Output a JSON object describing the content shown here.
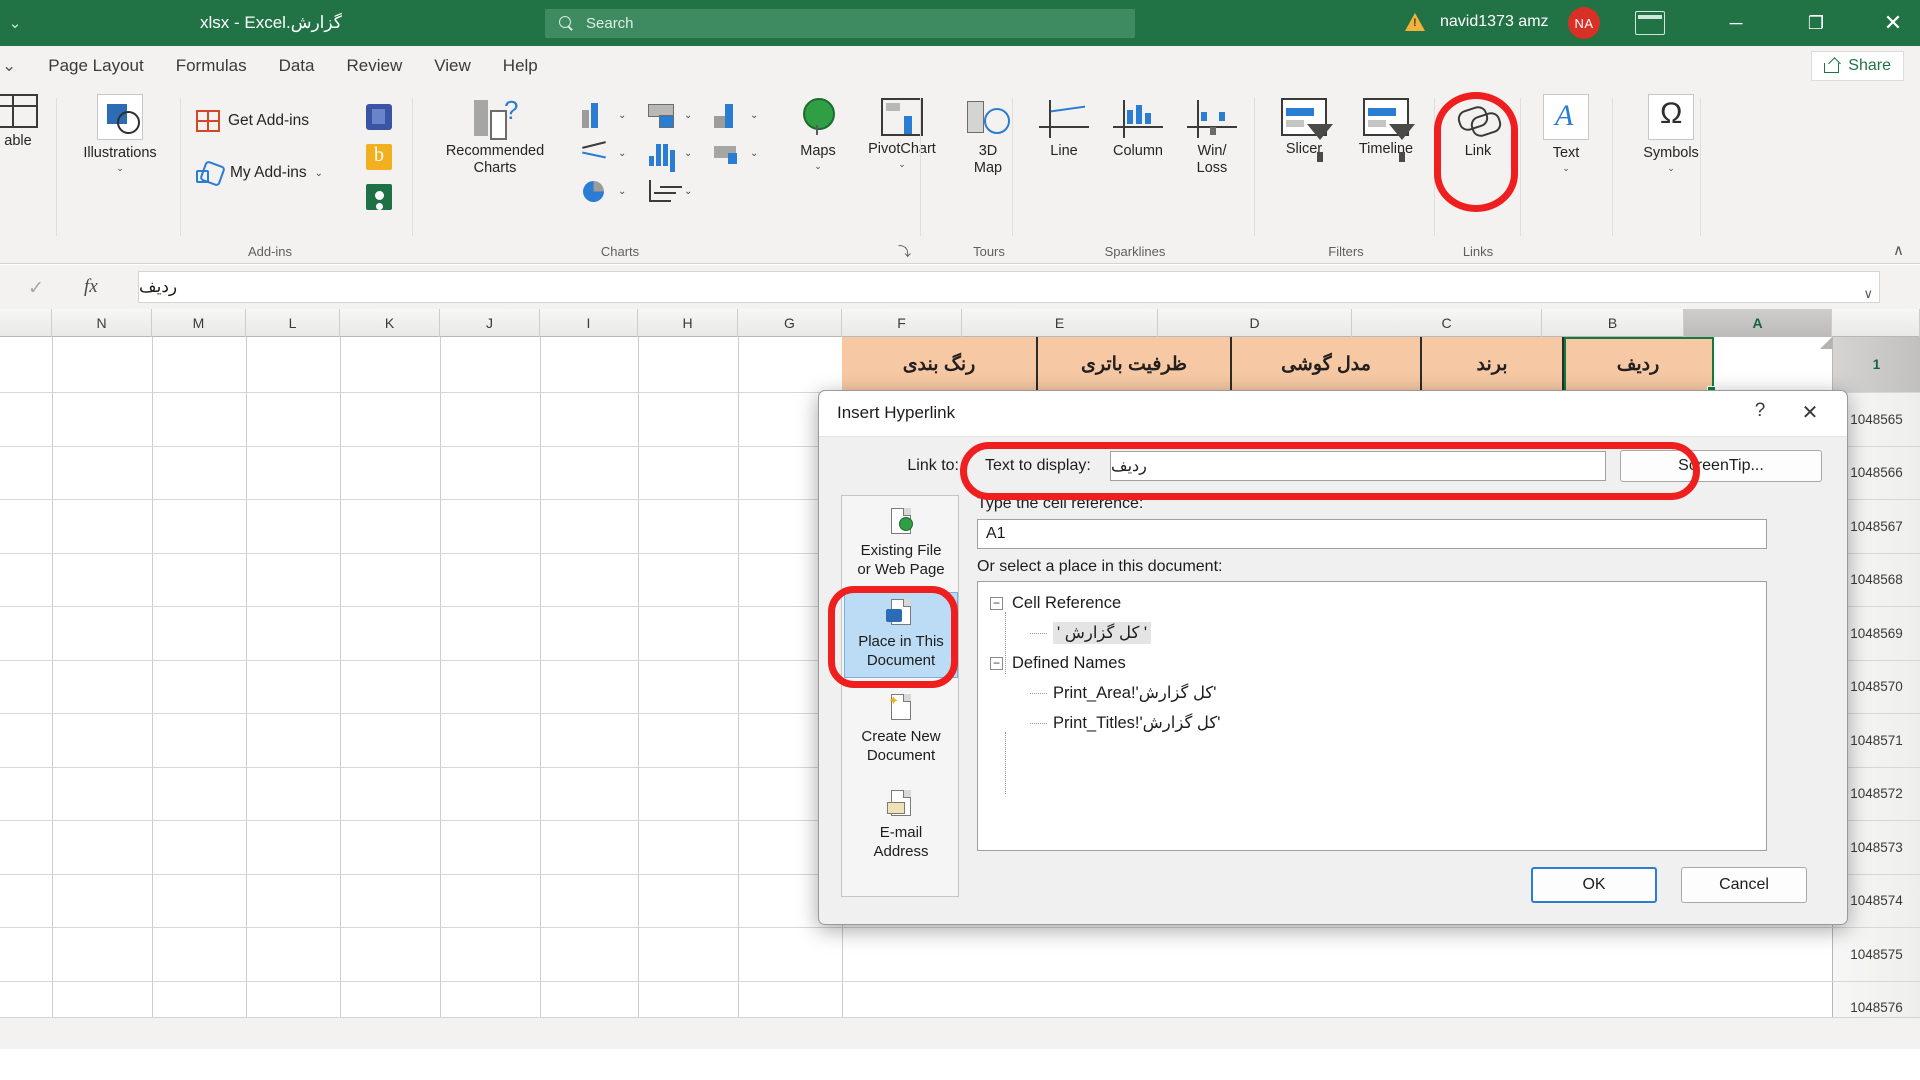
{
  "titlebar": {
    "document_title": "گزارش.xlsx - Excel",
    "search_placeholder": "Search",
    "user_name": "navid1373 amz",
    "avatar_initials": "NA",
    "minimize": "─",
    "maximize": "❐",
    "close": "✕",
    "accent_color": "#217346",
    "avatar_color": "#d93025"
  },
  "tabs": {
    "items": [
      {
        "label": "Page Layout"
      },
      {
        "label": "Formulas"
      },
      {
        "label": "Data"
      },
      {
        "label": "Review"
      },
      {
        "label": "View"
      },
      {
        "label": "Help"
      }
    ],
    "share_label": "Share"
  },
  "ribbon": {
    "groups": [
      {
        "label": "Add-ins"
      },
      {
        "label": "Charts"
      },
      {
        "label": "Tours"
      },
      {
        "label": "Sparklines"
      },
      {
        "label": "Filters"
      },
      {
        "label": "Links"
      }
    ],
    "buttons": {
      "table": "able",
      "illustrations": "Illustrations",
      "get_addins": "Get Add-ins",
      "my_addins": "My Add-ins",
      "recommended_charts_1": "Recommended",
      "recommended_charts_2": "Charts",
      "maps": "Maps",
      "pivotchart": "PivotChart",
      "map3d_1": "3D",
      "map3d_2": "Map",
      "line": "Line",
      "column": "Column",
      "winloss_1": "Win/",
      "winloss_2": "Loss",
      "slicer": "Slicer",
      "timeline": "Timeline",
      "link": "Link",
      "text": "Text",
      "symbols": "Symbols"
    },
    "dialog_launcher": "⤵",
    "collapse": "∧"
  },
  "formula_bar": {
    "check_icon": "✓",
    "fx_icon": "fx",
    "value": "ردیف",
    "expand_chevron": "∨"
  },
  "grid": {
    "columns": [
      "N",
      "M",
      "L",
      "K",
      "J",
      "I",
      "H",
      "G",
      "F",
      "E",
      "D",
      "C",
      "B",
      "A"
    ],
    "selected_column": "A",
    "row_numbers": [
      "1",
      "1048565",
      "1048566",
      "1048567",
      "1048568",
      "1048569",
      "1048570",
      "1048571",
      "1048572",
      "1048573",
      "1048574",
      "1048575",
      "1048576"
    ],
    "selected_row": "1",
    "header_cells": [
      {
        "col": "A",
        "text": "ردیف"
      },
      {
        "col": "B",
        "text": "برند"
      },
      {
        "col": "C",
        "text": "مدل گوشی"
      },
      {
        "col": "D",
        "text": "ظرفیت باتری"
      },
      {
        "col": "E",
        "text": "رنگ بندی"
      }
    ],
    "header_fill": "#f6c9a4",
    "selection_color": "#107c41"
  },
  "dialog": {
    "title": "Insert Hyperlink",
    "help_button": "?",
    "close_button": "✕",
    "link_to_label": "Link to:",
    "text_to_display_label": "Text to display:",
    "text_to_display_value": "ردیف",
    "screentip_button": "ScreenTip...",
    "left_panel": [
      {
        "line1": "Existing File",
        "line2": "or Web Page",
        "selected": false
      },
      {
        "line1": "Place in This",
        "line2": "Document",
        "selected": true
      },
      {
        "line1": "Create New",
        "line2": "Document",
        "selected": false
      },
      {
        "line1": "E-mail",
        "line2": "Address",
        "selected": false
      }
    ],
    "cell_reference_label": "Type the cell reference:",
    "cell_reference_value": "A1",
    "place_label": "Or select a place in this document:",
    "tree": [
      {
        "level": 0,
        "label": "Cell Reference",
        "expander": "−",
        "selected": false,
        "rtl": false
      },
      {
        "level": 1,
        "label": "' کل گزارش '",
        "expander": "",
        "selected": true,
        "rtl": true
      },
      {
        "level": 0,
        "label": "Defined Names",
        "expander": "−",
        "selected": false,
        "rtl": false
      },
      {
        "level": 1,
        "label": "'کل گزارش'!Print_Area",
        "expander": "",
        "selected": false,
        "rtl": true
      },
      {
        "level": 1,
        "label": "'کل گزارش'!Print_Titles",
        "expander": "",
        "selected": false,
        "rtl": true
      }
    ],
    "ok_button": "OK",
    "cancel_button": "Cancel",
    "annotation_color": "#f01f1f"
  }
}
